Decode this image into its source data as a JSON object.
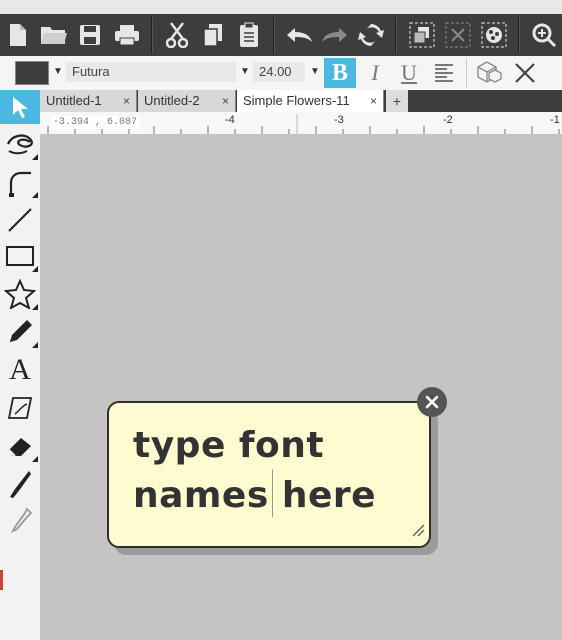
{
  "toolbar": {
    "icons": [
      "new-document-icon",
      "open-folder-icon",
      "save-icon",
      "print-icon",
      "cut-icon",
      "copy-icon",
      "paste-icon",
      "undo-icon",
      "redo-icon",
      "sync-icon",
      "group-icon",
      "ungroup-icon",
      "compound-icon",
      "zoom-icon"
    ]
  },
  "text_toolbar": {
    "fill_color": "#3d3d3d",
    "font_name": "Futura",
    "font_size": "24.00",
    "bold_label": "B",
    "italic_label": "I",
    "underline_label": "U",
    "bold_active_color": "#4bb8e2"
  },
  "tabs": [
    {
      "label": "Untitled-1",
      "close": "×"
    },
    {
      "label": "Untitled-2",
      "close": "×"
    },
    {
      "label": "Simple Flowers-11",
      "close": "×"
    }
  ],
  "add_tab_label": "+",
  "ruler": {
    "coordinates": "-3.394 , 6.087",
    "ticks": [
      "-4",
      "-3",
      "-2",
      "-1"
    ]
  },
  "tools": [
    "select-tool-icon",
    "point-edit-tool-icon",
    "freehand-tool-icon",
    "line-tool-icon",
    "rectangle-tool-icon",
    "star-tool-icon",
    "pencil-tool-icon",
    "text-tool-icon",
    "text-on-path-tool-icon",
    "eraser-tool-icon",
    "knife-tool-icon",
    "eyedropper-tool-icon"
  ],
  "note": {
    "line1": "type font",
    "line2a": "names ",
    "line2b": "here"
  }
}
